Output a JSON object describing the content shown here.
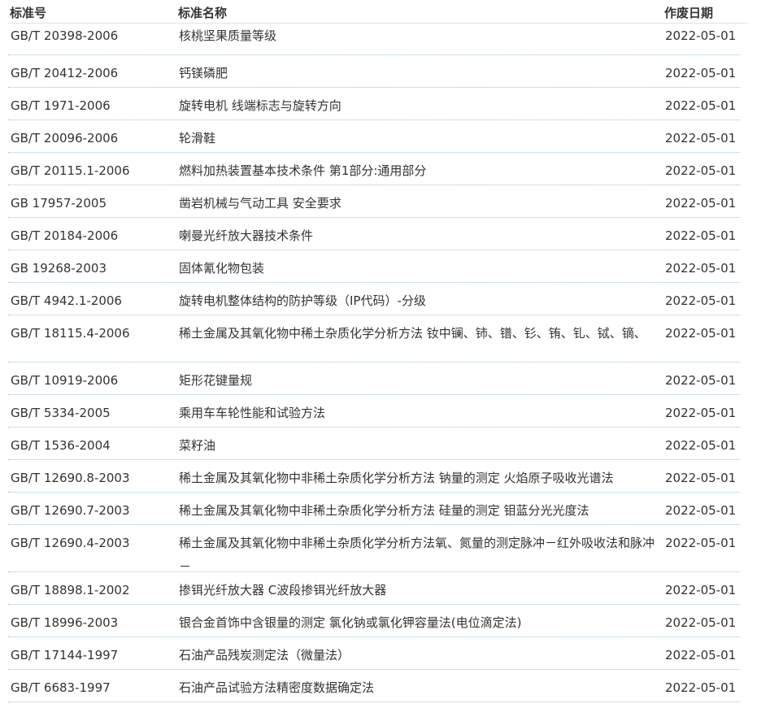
{
  "columns": {
    "code": "标准号",
    "name": "标准名称",
    "date": "作废日期"
  },
  "rows": [
    {
      "code": "GB/T 20398-2006",
      "name": "核桃坚果质量等级",
      "date": "2022-05-01"
    },
    {
      "code": "GB/T 20412-2006",
      "name": "钙镁磷肥",
      "date": "2022-05-01"
    },
    {
      "code": "GB/T 1971-2006",
      "name": "旋转电机 线端标志与旋转方向",
      "date": "2022-05-01"
    },
    {
      "code": "GB/T 20096-2006",
      "name": "轮滑鞋",
      "date": "2022-05-01"
    },
    {
      "code": "GB/T 20115.1-2006",
      "name": "燃料加热装置基本技术条件 第1部分:通用部分",
      "date": "2022-05-01"
    },
    {
      "code": "GB 17957-2005",
      "name": "凿岩机械与气动工具 安全要求",
      "date": "2022-05-01"
    },
    {
      "code": "GB/T 20184-2006",
      "name": "喇曼光纤放大器技术条件",
      "date": "2022-05-01"
    },
    {
      "code": "GB 19268-2003",
      "name": "固体氰化物包装",
      "date": "2022-05-01"
    },
    {
      "code": "GB/T 4942.1-2006",
      "name": "旋转电机整体结构的防护等级（IP代码）-分级",
      "date": "2022-05-01"
    },
    {
      "code": "GB/T 18115.4-2006",
      "name": "稀土金属及其氧化物中稀土杂质化学分析方法 钕中镧、铈、镨、钐、铕、钆、铽、镝、",
      "date": "2022-05-01"
    },
    {
      "code": "GB/T 10919-2006",
      "name": "矩形花键量规",
      "date": "2022-05-01"
    },
    {
      "code": "GB/T 5334-2005",
      "name": "乘用车车轮性能和试验方法",
      "date": "2022-05-01"
    },
    {
      "code": "GB/T 1536-2004",
      "name": "菜籽油",
      "date": "2022-05-01"
    },
    {
      "code": "GB/T 12690.8-2003",
      "name": "稀土金属及其氧化物中非稀土杂质化学分析方法 钠量的测定 火焰原子吸收光谱法",
      "date": "2022-05-01"
    },
    {
      "code": "GB/T 12690.7-2003",
      "name": "稀土金属及其氧化物中非稀土杂质化学分析方法 硅量的测定 钼蓝分光光度法",
      "date": "2022-05-01"
    },
    {
      "code": "GB/T 12690.4-2003",
      "name": "稀土金属及其氧化物中非稀土杂质化学分析方法氧、氮量的测定脉冲－红外吸收法和脉冲－",
      "date": "2022-05-01"
    },
    {
      "code": "GB/T 18898.1-2002",
      "name": "掺铒光纤放大器 C波段掺铒光纤放大器",
      "date": "2022-05-01"
    },
    {
      "code": "GB/T 18996-2003",
      "name": "银合金首饰中含银量的测定 氯化钠或氯化钾容量法(电位滴定法)",
      "date": "2022-05-01"
    },
    {
      "code": "GB/T 17144-1997",
      "name": "石油产品残炭测定法（微量法）",
      "date": "2022-05-01"
    },
    {
      "code": "GB/T 6683-1997",
      "name": "石油产品试验方法精密度数据确定法",
      "date": "2022-05-01"
    }
  ]
}
